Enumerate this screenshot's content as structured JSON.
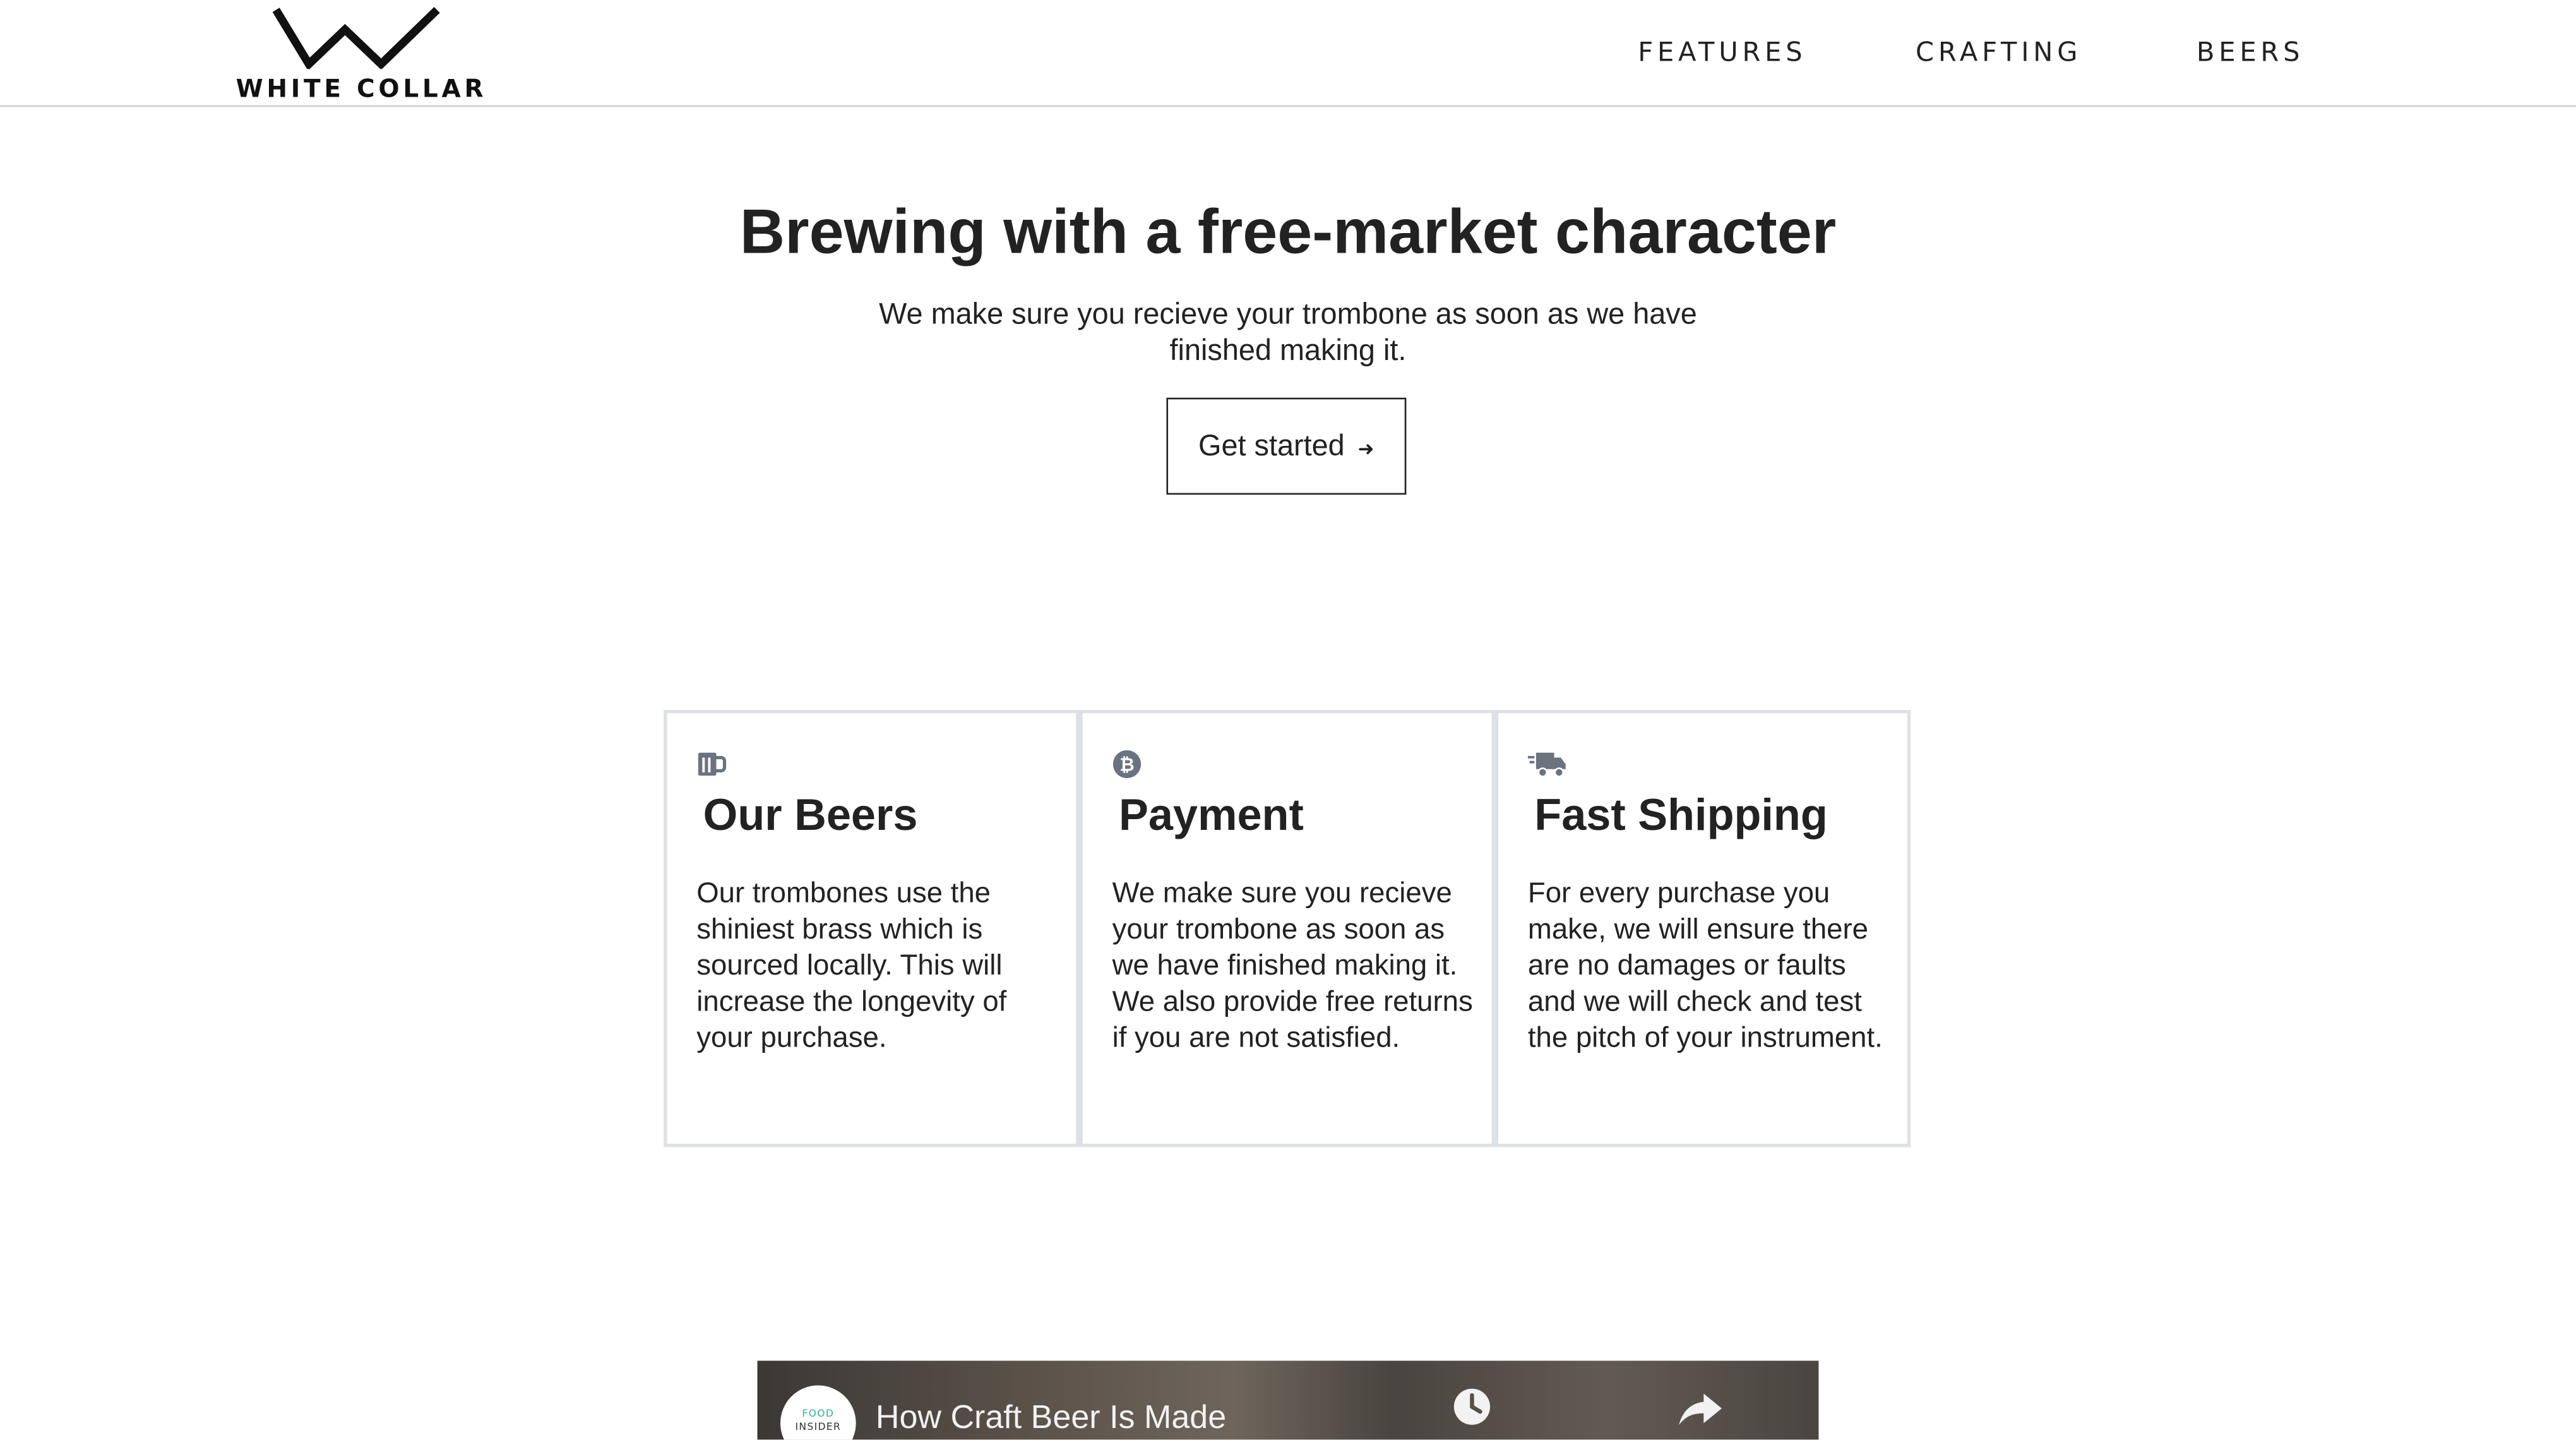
{
  "brand": {
    "name": "WHITE COLLAR",
    "logo_icon": "crown-w-logo"
  },
  "nav": {
    "items": [
      {
        "label": "FEATURES"
      },
      {
        "label": "CRAFTING"
      },
      {
        "label": "BEERS"
      }
    ]
  },
  "hero": {
    "title": "Brewing with a free-market character",
    "subtitle": "We make sure you recieve your trombone as soon as we have finished making it.",
    "cta_label": "Get started",
    "cta_icon": "arrow-right-icon"
  },
  "features": [
    {
      "icon": "beer-mug-icon",
      "title": "Our Beers",
      "text": "Our trombones use the shiniest brass which is sourced locally. This will increase the longevity of your purchase."
    },
    {
      "icon": "bitcoin-icon",
      "title": "Payment",
      "text": "We make sure you recieve your trombone as soon as we have finished making it. We also provide free returns if you are not satisfied."
    },
    {
      "icon": "shipping-truck-icon",
      "title": "Fast Shipping",
      "text": "For every purchase you make, we will ensure there are no damages or faults and we will check and test the pitch of your instrument."
    }
  ],
  "video": {
    "title": "How Craft Beer Is Made",
    "channel_line1": "FOOD",
    "channel_line2": "INSIDER"
  },
  "colors": {
    "text": "#222222",
    "border": "#dde0e4",
    "icon": "#6b7280",
    "header_rule": "#cfcfcf",
    "channel_accent": "#2bb5a0"
  }
}
